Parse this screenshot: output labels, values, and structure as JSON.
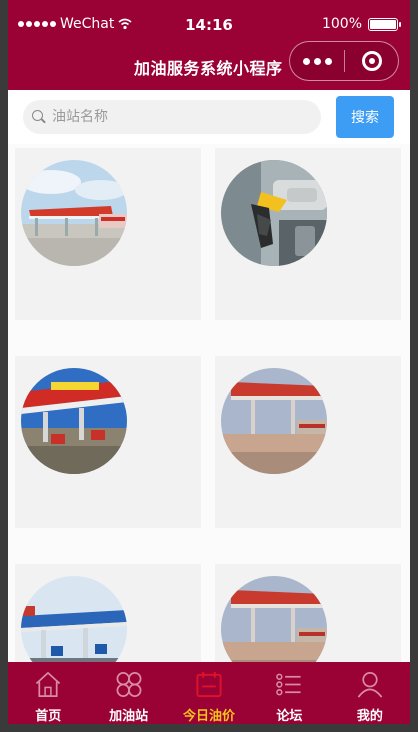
{
  "status_bar": {
    "carrier": "WeChat",
    "time": "14:16",
    "battery": "100%",
    "battery_fraction": 1.0
  },
  "nav_bar": {
    "title": "加油服务系统小程序"
  },
  "search": {
    "placeholder": "油站名称",
    "button_label": "搜索"
  },
  "stations": [
    {
      "image": "gas-station-photo-1"
    },
    {
      "image": "fuel-nozzle-photo"
    },
    {
      "image": "gas-station-photo-2"
    },
    {
      "image": "gas-station-photo-3"
    },
    {
      "image": "gas-station-photo-4"
    },
    {
      "image": "gas-station-photo-5"
    }
  ],
  "tab_bar": {
    "active_index": 2,
    "tabs": [
      {
        "label": "首页",
        "icon": "home-icon"
      },
      {
        "label": "加油站",
        "icon": "grid-icon"
      },
      {
        "label": "今日油价",
        "icon": "calendar-icon"
      },
      {
        "label": "论坛",
        "icon": "list-icon"
      },
      {
        "label": "我的",
        "icon": "user-icon"
      }
    ]
  },
  "colors": {
    "brand": "#9a0134",
    "accent": "#f6c31c",
    "search_button": "#3d9df5"
  }
}
